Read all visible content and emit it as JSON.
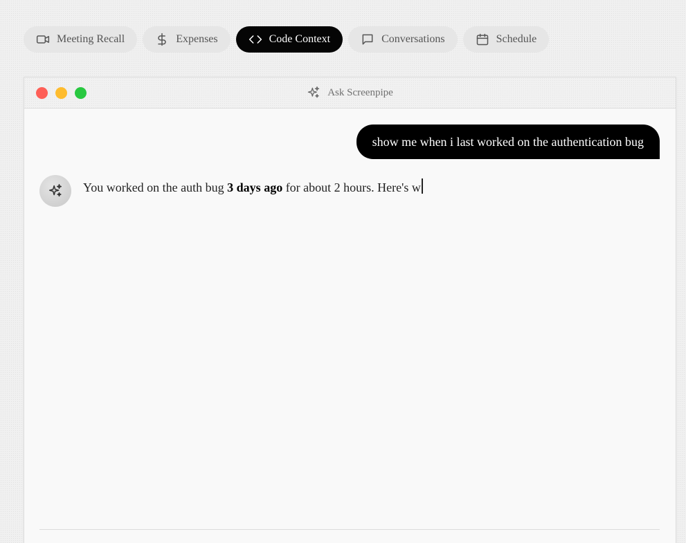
{
  "tabs": [
    {
      "label": "Meeting Recall",
      "icon": "video-icon",
      "active": false
    },
    {
      "label": "Expenses",
      "icon": "dollar-icon",
      "active": false
    },
    {
      "label": "Code Context",
      "icon": "code-icon",
      "active": true
    },
    {
      "label": "Conversations",
      "icon": "message-icon",
      "active": false
    },
    {
      "label": "Schedule",
      "icon": "calendar-icon",
      "active": false
    }
  ],
  "window": {
    "title": "Ask Screenpipe",
    "title_icon": "sparkles-icon"
  },
  "chat": {
    "user_message": "show me when i last worked on the authentication bug",
    "assistant": {
      "avatar_icon": "sparkles-icon",
      "text_before": "You worked on the auth bug ",
      "text_bold": "3 days ago",
      "text_after": " for about 2 hours. Here's w"
    }
  },
  "colors": {
    "active_tab": "#050505",
    "inactive_tab": "#e6e6e6",
    "traffic_red": "#fe5f57",
    "traffic_yellow": "#febc2e",
    "traffic_green": "#28c840"
  }
}
